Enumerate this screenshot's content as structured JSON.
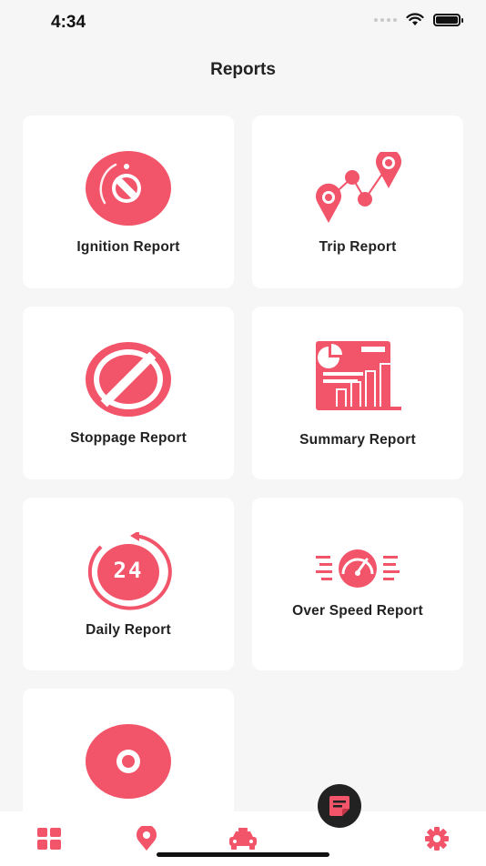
{
  "status_bar": {
    "time": "4:34"
  },
  "header": {
    "title": "Reports"
  },
  "reports": [
    {
      "label": "Ignition Report",
      "icon": "ignition-icon"
    },
    {
      "label": "Trip Report",
      "icon": "trip-route-icon"
    },
    {
      "label": "Stoppage Report",
      "icon": "stoppage-icon"
    },
    {
      "label": "Summary Report",
      "icon": "summary-chart-icon"
    },
    {
      "label": "Daily Report",
      "icon": "daily-24-icon",
      "icon_text": "24"
    },
    {
      "label": "Over Speed Report",
      "icon": "speedometer-icon"
    },
    {
      "label": "",
      "icon": "report-circle-icon"
    }
  ],
  "bottom_nav": {
    "items": [
      "dashboard-icon",
      "location-pin-icon",
      "car-icon",
      "reports-icon",
      "settings-icon"
    ],
    "active": "reports-icon"
  },
  "colors": {
    "accent": "#f2546a",
    "background": "#f6f6f6",
    "card": "#ffffff",
    "nav_active_bg": "#222222"
  }
}
